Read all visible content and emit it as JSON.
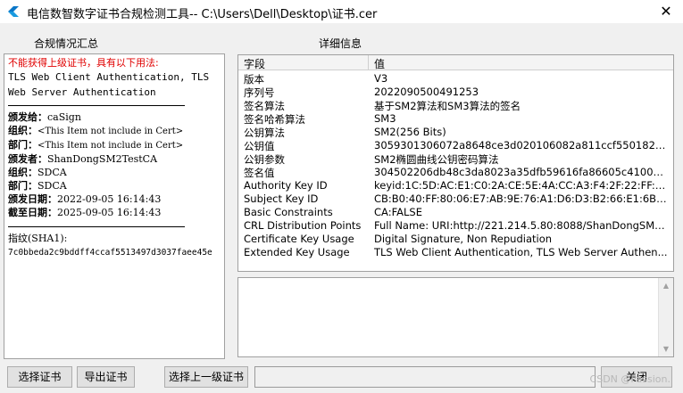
{
  "window": {
    "title": "电信数智数字证书合规检测工具-- C:\\Users\\Dell\\Desktop\\证书.cer",
    "close_glyph": "✕"
  },
  "summary": {
    "heading": "合规情况汇总",
    "warning": "不能获得上级证书，具有以下用法:",
    "usage_line1": "TLS Web Client Authentication, TLS",
    "usage_line2": "Web Server Authentication",
    "issued_to_label": "颁发给：",
    "issued_to_value": "caSign",
    "org_label": "组织：",
    "org_value": "<This Item not include in Cert>",
    "dept_label": "部门：",
    "dept_value": "<This Item not include in Cert>",
    "issuer_label": "颁发者：",
    "issuer_value": "ShanDongSM2TestCA",
    "issuer_org_label": "组织：",
    "issuer_org_value": "SDCA",
    "issuer_dept_label": "部门：",
    "issuer_dept_value": "SDCA",
    "issue_date_label": "颁发日期：",
    "issue_date_value": "2022-09-05 16:14:43",
    "expire_date_label": "截至日期：",
    "expire_date_value": "2025-09-05 16:14:43",
    "fingerprint_label": "指纹(SHA1):",
    "fingerprint_value": "7c0bbeda2c9bddff4ccaf5513497d3037faee45e"
  },
  "details": {
    "heading": "详细信息",
    "col_field": "字段",
    "col_value": "值",
    "rows": [
      {
        "field": "版本",
        "value": "V3"
      },
      {
        "field": "序列号",
        "value": "2022090500491253"
      },
      {
        "field": "签名算法",
        "value": "基于SM2算法和SM3算法的签名"
      },
      {
        "field": "签名哈希算法",
        "value": "SM3"
      },
      {
        "field": "公钥算法",
        "value": "SM2(256 Bits)"
      },
      {
        "field": "公钥值",
        "value": "3059301306072a8648ce3d020106082a811ccf5501822d..."
      },
      {
        "field": "公钥参数",
        "value": "SM2椭圆曲线公钥密码算法"
      },
      {
        "field": "签名值",
        "value": "304502206db48c3da8023a35dfb59616fa86605c4100d2..."
      },
      {
        "field": "Authority Key ID",
        "value": "keyid:1C:5D:AC:E1:C0:2A:CE:5E:4A:CC:A3:F4:2F:22:FF:A..."
      },
      {
        "field": "Subject Key ID",
        "value": "CB:B0:40:FF:80:06:E7:AB:9E:76:A1:D6:D3:B2:66:E1:6B:1..."
      },
      {
        "field": "Basic Constraints",
        "value": "CA:FALSE"
      },
      {
        "field": "CRL Distribution Points",
        "value": "Full Name:  URI:http://221.214.5.80:8088/ShanDongSM2..."
      },
      {
        "field": "Certificate Key Usage",
        "value": "Digital Signature, Non Repudiation"
      },
      {
        "field": "Extended Key Usage",
        "value": "TLS Web Client Authentication, TLS Web Server Authen..."
      }
    ]
  },
  "buttons": {
    "select_cert": "选择证书",
    "export_cert": "导出证书",
    "select_parent": "选择上一级证书",
    "close": "关闭"
  },
  "watermark": "CSDN @Passion."
}
